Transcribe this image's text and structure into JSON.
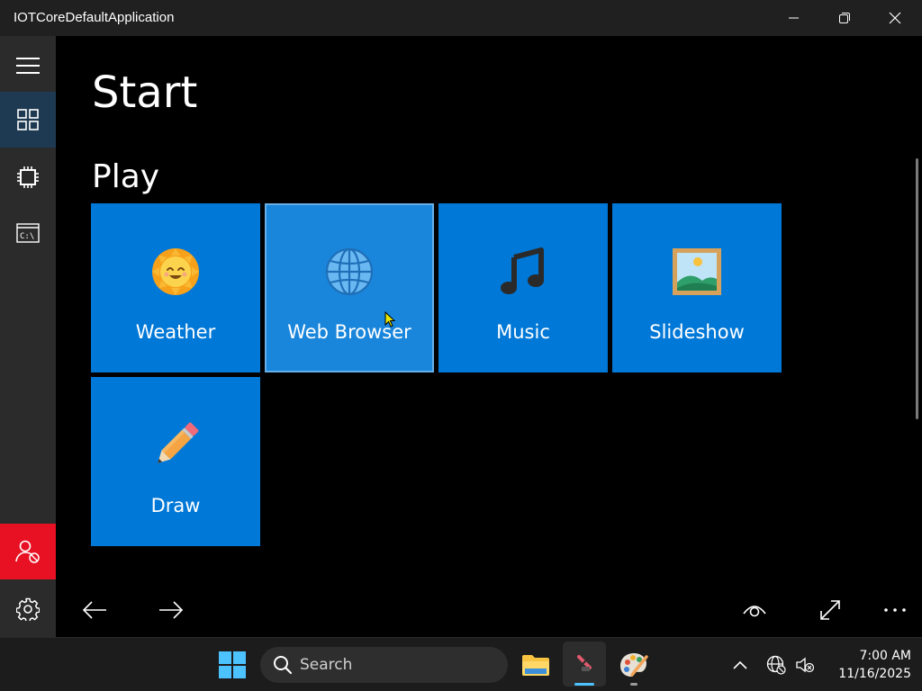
{
  "window": {
    "title": "IOTCoreDefaultApplication"
  },
  "page": {
    "title": "Start",
    "section": "Play"
  },
  "tiles": [
    {
      "label": "Weather",
      "icon": "sun-with-face-icon"
    },
    {
      "label": "Web Browser",
      "icon": "globe-icon"
    },
    {
      "label": "Music",
      "icon": "music-note-icon"
    },
    {
      "label": "Slideshow",
      "icon": "framed-picture-icon"
    },
    {
      "label": "Draw",
      "icon": "pencil-icon"
    }
  ],
  "sidebar": {
    "items": [
      {
        "icon": "hamburger-menu-icon"
      },
      {
        "icon": "tiles-grid-icon",
        "active": true
      },
      {
        "icon": "chip-icon"
      },
      {
        "icon": "command-prompt-icon",
        "text": "C:\\"
      },
      {
        "icon": "user-blocked-icon"
      },
      {
        "icon": "gear-icon"
      }
    ]
  },
  "taskbar": {
    "search_placeholder": "Search",
    "time": "7:00 AM",
    "date": "11/16/2025"
  },
  "colors": {
    "tile": "#0078d7",
    "sidebar": "#2b2b2b",
    "sidebar_active": "#1e3a52",
    "alert": "#e81123",
    "taskbar": "#1c1c1c"
  }
}
